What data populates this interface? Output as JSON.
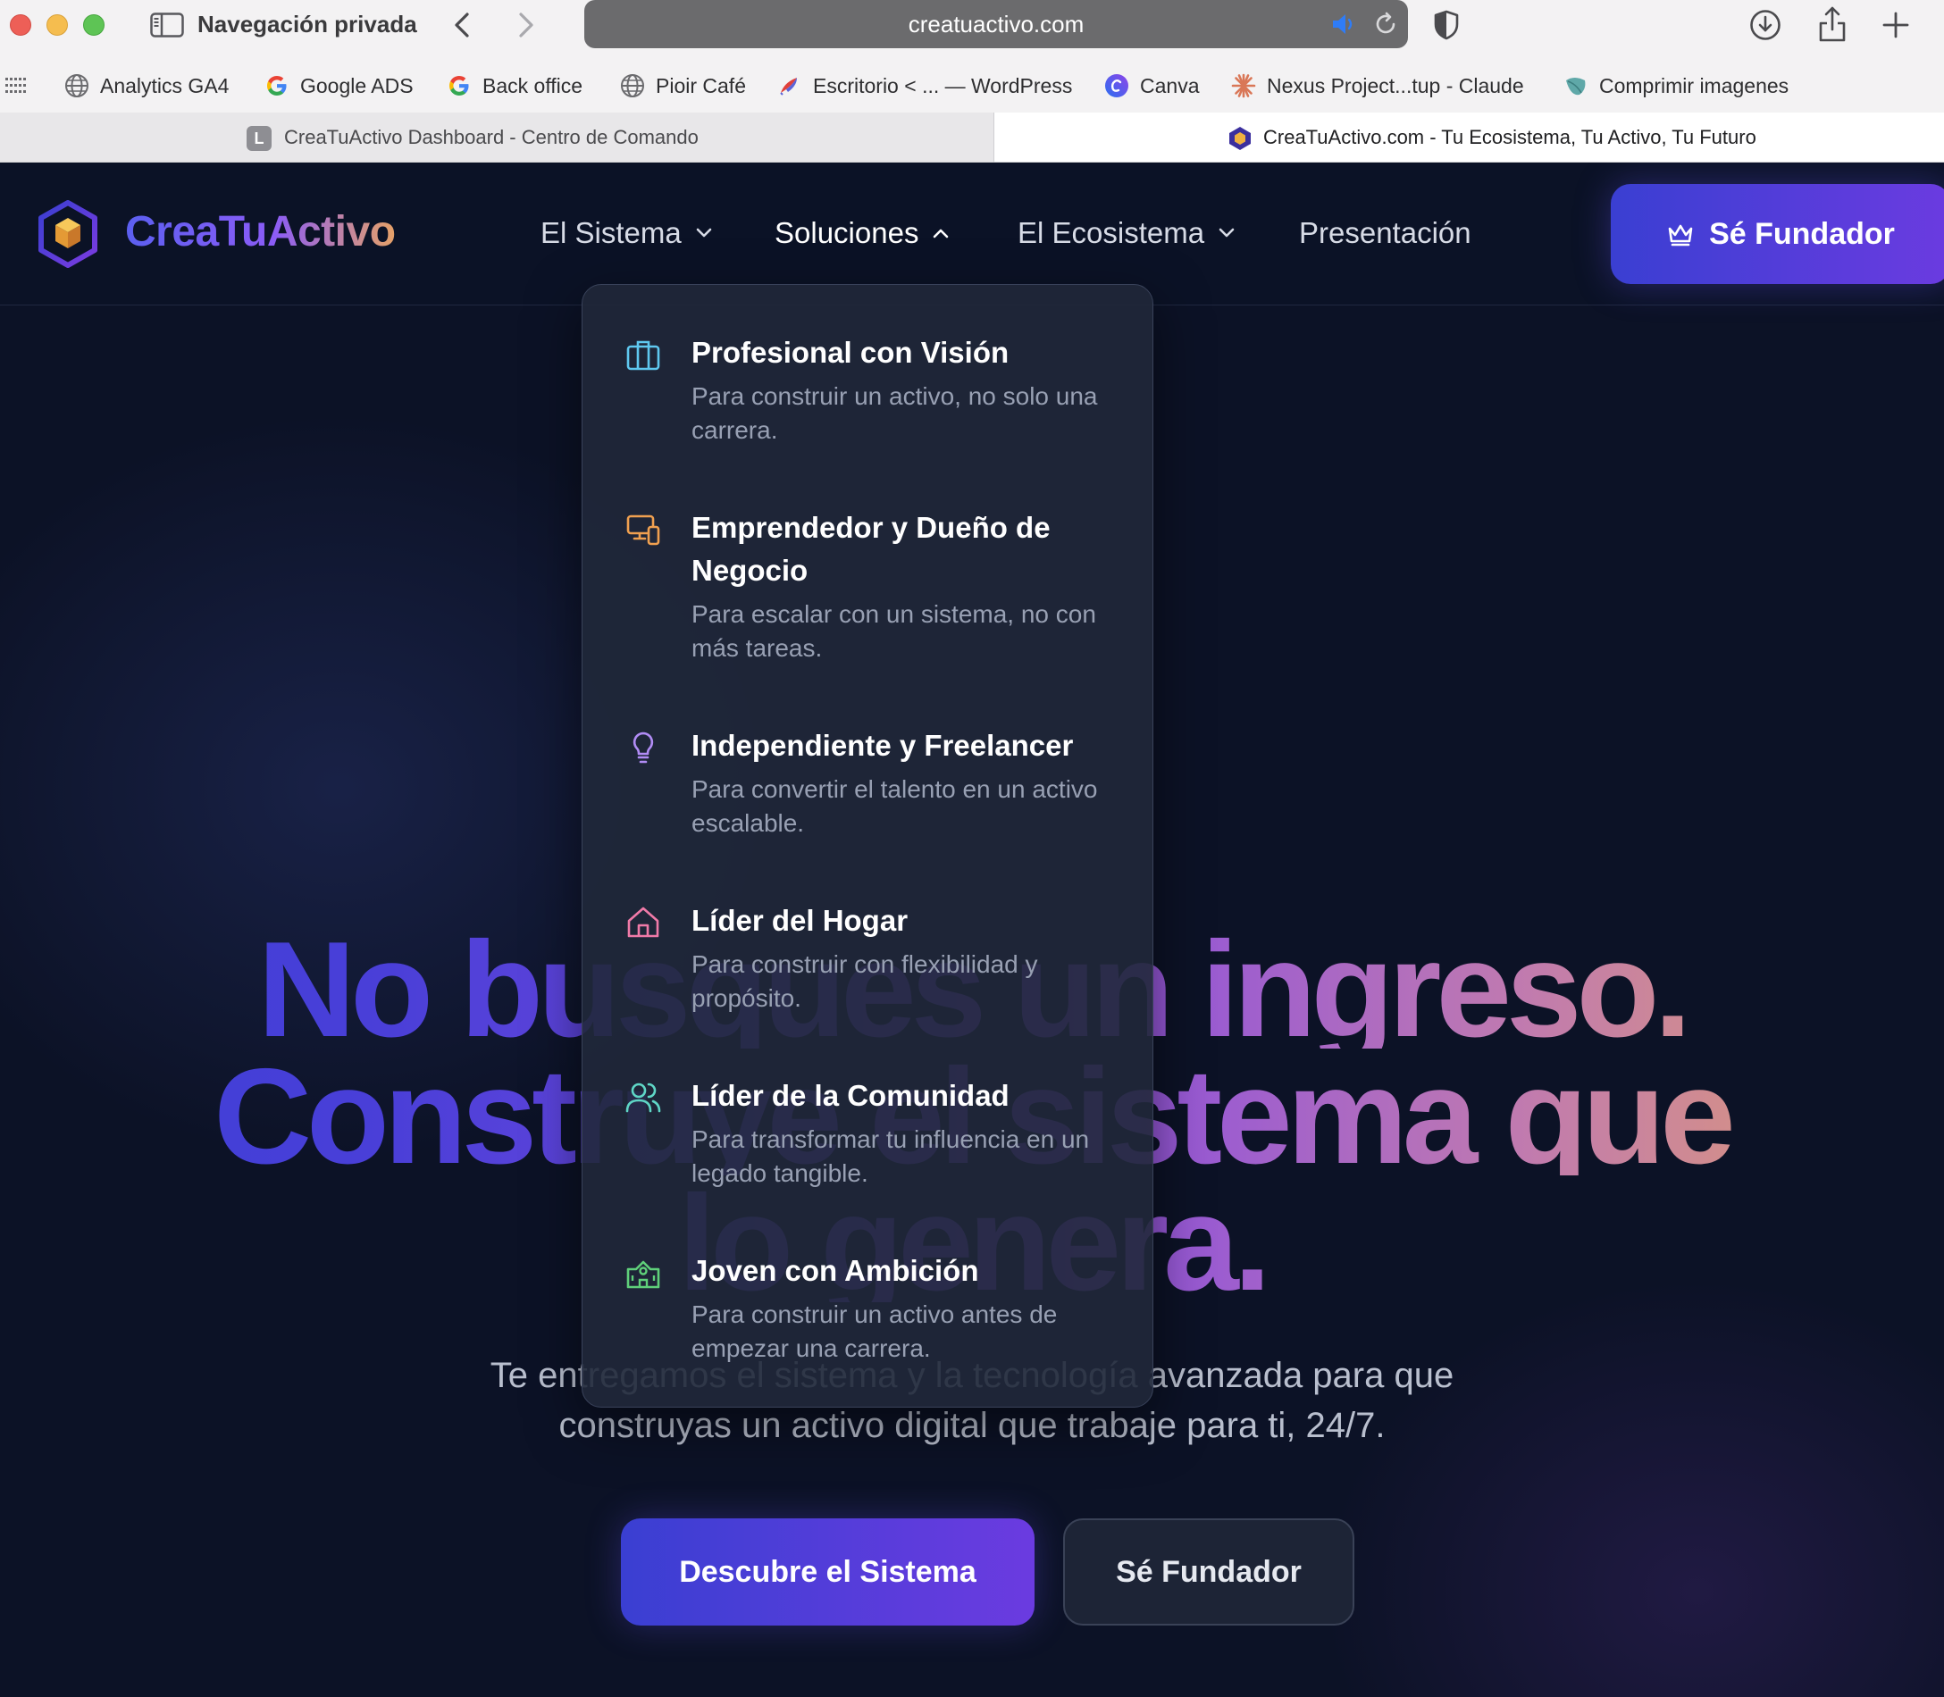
{
  "browser": {
    "private_label": "Navegación privada",
    "url": "creatuactivo.com",
    "bookmarks": [
      {
        "label": "Analytics GA4",
        "icon": "globe-icon"
      },
      {
        "label": "Google ADS",
        "icon": "google-icon"
      },
      {
        "label": "Back office",
        "icon": "google-icon"
      },
      {
        "label": "Pioir Café",
        "icon": "globe-icon"
      },
      {
        "label": "Escritorio < ... — WordPress",
        "icon": "wordpress-feather-icon"
      },
      {
        "label": "Canva",
        "icon": "canva-icon"
      },
      {
        "label": "Nexus Project...tup - Claude",
        "icon": "claude-star-icon"
      },
      {
        "label": "Comprimir imagenes",
        "icon": "leaf-icon"
      }
    ],
    "tabs": [
      {
        "label": "CreaTuActivo Dashboard - Centro de Comando",
        "favicon_letter": "L",
        "active": false
      },
      {
        "label": "CreaTuActivo.com - Tu Ecosistema, Tu Activo, Tu Futuro",
        "active": true
      }
    ]
  },
  "site": {
    "brand": "CreaTuActivo",
    "nav": [
      {
        "label": "El Sistema",
        "has_dropdown": true,
        "open": false
      },
      {
        "label": "Soluciones",
        "has_dropdown": true,
        "open": true
      },
      {
        "label": "El Ecosistema",
        "has_dropdown": true,
        "open": false
      },
      {
        "label": "Presentación",
        "has_dropdown": false
      }
    ],
    "cta": "Sé Fundador"
  },
  "dropdown": {
    "items": [
      {
        "title": "Profesional con Visión",
        "desc": "Para construir un activo, no solo una carrera.",
        "icon": "briefcase-icon",
        "color": "#5fc8f0"
      },
      {
        "title": "Emprendedor y Dueño de Negocio",
        "desc": "Para escalar con un sistema, no con más tareas.",
        "icon": "devices-icon",
        "color": "#f0a050"
      },
      {
        "title": "Independiente y Freelancer",
        "desc": "Para convertir el talento en un activo escalable.",
        "icon": "lightbulb-icon",
        "color": "#b18cf5"
      },
      {
        "title": "Líder del Hogar",
        "desc": "Para construir con flexibilidad y propósito.",
        "icon": "home-icon",
        "color": "#f07aa8"
      },
      {
        "title": "Líder de la Comunidad",
        "desc": "Para transformar tu influencia en un legado tangible.",
        "icon": "users-icon",
        "color": "#5fd6c6"
      },
      {
        "title": "Joven con Ambición",
        "desc": "Para construir un activo antes de empezar una carrera.",
        "icon": "school-icon",
        "color": "#5fd07a"
      }
    ]
  },
  "hero": {
    "line1": "No busques un ingreso.",
    "line2": "Construye el sistema que",
    "line3": "lo genera.",
    "subtitle_line1": "Te entregamos el sistema y la tecnología avanzada para que",
    "subtitle_line2": "construyas un activo digital que trabaje para ti, 24/7.",
    "primary_button": "Descubre el Sistema",
    "secondary_button": "Sé Fundador"
  },
  "colors": {
    "page_bg": "#0c1226",
    "brand_indigo": "#3a3fd2",
    "brand_violet": "#6b3be0",
    "brand_orange": "#e3a06a"
  }
}
